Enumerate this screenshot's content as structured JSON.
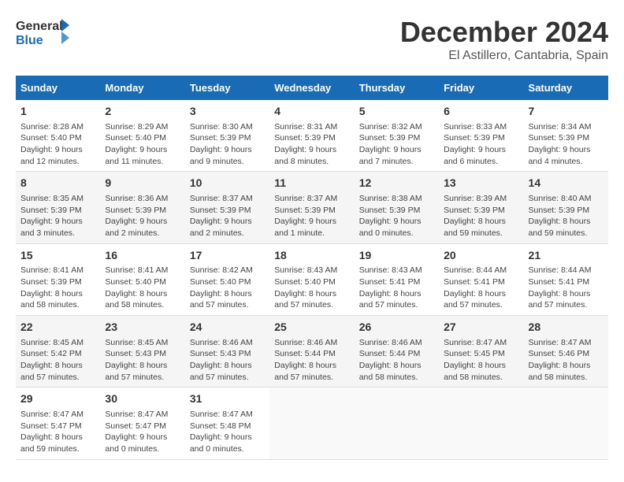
{
  "header": {
    "logo_line1": "General",
    "logo_line2": "Blue",
    "month": "December 2024",
    "location": "El Astillero, Cantabria, Spain"
  },
  "weekdays": [
    "Sunday",
    "Monday",
    "Tuesday",
    "Wednesday",
    "Thursday",
    "Friday",
    "Saturday"
  ],
  "weeks": [
    [
      {
        "day": "1",
        "info": "Sunrise: 8:28 AM\nSunset: 5:40 PM\nDaylight: 9 hours\nand 12 minutes."
      },
      {
        "day": "2",
        "info": "Sunrise: 8:29 AM\nSunset: 5:40 PM\nDaylight: 9 hours\nand 11 minutes."
      },
      {
        "day": "3",
        "info": "Sunrise: 8:30 AM\nSunset: 5:39 PM\nDaylight: 9 hours\nand 9 minutes."
      },
      {
        "day": "4",
        "info": "Sunrise: 8:31 AM\nSunset: 5:39 PM\nDaylight: 9 hours\nand 8 minutes."
      },
      {
        "day": "5",
        "info": "Sunrise: 8:32 AM\nSunset: 5:39 PM\nDaylight: 9 hours\nand 7 minutes."
      },
      {
        "day": "6",
        "info": "Sunrise: 8:33 AM\nSunset: 5:39 PM\nDaylight: 9 hours\nand 6 minutes."
      },
      {
        "day": "7",
        "info": "Sunrise: 8:34 AM\nSunset: 5:39 PM\nDaylight: 9 hours\nand 4 minutes."
      }
    ],
    [
      {
        "day": "8",
        "info": "Sunrise: 8:35 AM\nSunset: 5:39 PM\nDaylight: 9 hours\nand 3 minutes."
      },
      {
        "day": "9",
        "info": "Sunrise: 8:36 AM\nSunset: 5:39 PM\nDaylight: 9 hours\nand 2 minutes."
      },
      {
        "day": "10",
        "info": "Sunrise: 8:37 AM\nSunset: 5:39 PM\nDaylight: 9 hours\nand 2 minutes."
      },
      {
        "day": "11",
        "info": "Sunrise: 8:37 AM\nSunset: 5:39 PM\nDaylight: 9 hours\nand 1 minute."
      },
      {
        "day": "12",
        "info": "Sunrise: 8:38 AM\nSunset: 5:39 PM\nDaylight: 9 hours\nand 0 minutes."
      },
      {
        "day": "13",
        "info": "Sunrise: 8:39 AM\nSunset: 5:39 PM\nDaylight: 8 hours\nand 59 minutes."
      },
      {
        "day": "14",
        "info": "Sunrise: 8:40 AM\nSunset: 5:39 PM\nDaylight: 8 hours\nand 59 minutes."
      }
    ],
    [
      {
        "day": "15",
        "info": "Sunrise: 8:41 AM\nSunset: 5:39 PM\nDaylight: 8 hours\nand 58 minutes."
      },
      {
        "day": "16",
        "info": "Sunrise: 8:41 AM\nSunset: 5:40 PM\nDaylight: 8 hours\nand 58 minutes."
      },
      {
        "day": "17",
        "info": "Sunrise: 8:42 AM\nSunset: 5:40 PM\nDaylight: 8 hours\nand 57 minutes."
      },
      {
        "day": "18",
        "info": "Sunrise: 8:43 AM\nSunset: 5:40 PM\nDaylight: 8 hours\nand 57 minutes."
      },
      {
        "day": "19",
        "info": "Sunrise: 8:43 AM\nSunset: 5:41 PM\nDaylight: 8 hours\nand 57 minutes."
      },
      {
        "day": "20",
        "info": "Sunrise: 8:44 AM\nSunset: 5:41 PM\nDaylight: 8 hours\nand 57 minutes."
      },
      {
        "day": "21",
        "info": "Sunrise: 8:44 AM\nSunset: 5:41 PM\nDaylight: 8 hours\nand 57 minutes."
      }
    ],
    [
      {
        "day": "22",
        "info": "Sunrise: 8:45 AM\nSunset: 5:42 PM\nDaylight: 8 hours\nand 57 minutes."
      },
      {
        "day": "23",
        "info": "Sunrise: 8:45 AM\nSunset: 5:43 PM\nDaylight: 8 hours\nand 57 minutes."
      },
      {
        "day": "24",
        "info": "Sunrise: 8:46 AM\nSunset: 5:43 PM\nDaylight: 8 hours\nand 57 minutes."
      },
      {
        "day": "25",
        "info": "Sunrise: 8:46 AM\nSunset: 5:44 PM\nDaylight: 8 hours\nand 57 minutes."
      },
      {
        "day": "26",
        "info": "Sunrise: 8:46 AM\nSunset: 5:44 PM\nDaylight: 8 hours\nand 58 minutes."
      },
      {
        "day": "27",
        "info": "Sunrise: 8:47 AM\nSunset: 5:45 PM\nDaylight: 8 hours\nand 58 minutes."
      },
      {
        "day": "28",
        "info": "Sunrise: 8:47 AM\nSunset: 5:46 PM\nDaylight: 8 hours\nand 58 minutes."
      }
    ],
    [
      {
        "day": "29",
        "info": "Sunrise: 8:47 AM\nSunset: 5:47 PM\nDaylight: 8 hours\nand 59 minutes."
      },
      {
        "day": "30",
        "info": "Sunrise: 8:47 AM\nSunset: 5:47 PM\nDaylight: 9 hours\nand 0 minutes."
      },
      {
        "day": "31",
        "info": "Sunrise: 8:47 AM\nSunset: 5:48 PM\nDaylight: 9 hours\nand 0 minutes."
      },
      null,
      null,
      null,
      null
    ]
  ]
}
